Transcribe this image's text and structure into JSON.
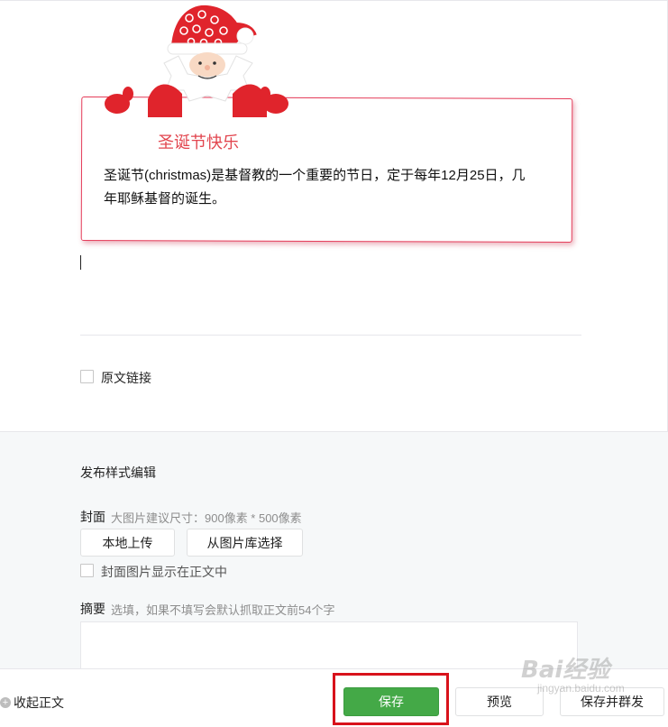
{
  "card": {
    "title": "圣诞节快乐",
    "body": "圣诞节(christmas)是基督教的一个重要的节日，定于每年12月25日，几年耶稣基督的诞生。"
  },
  "source_link": {
    "label": "原文链接",
    "checked": false
  },
  "publish_style": {
    "title": "发布样式编辑",
    "cover_label": "封面",
    "cover_hint": "大图片建议尺寸：900像素 * 500像素",
    "upload_local": "本地上传",
    "choose_library": "从图片库选择",
    "show_in_body": "封面图片显示在正文中",
    "summary_label": "摘要",
    "summary_hint": "选填，如果不填写会默认抓取正文前54个字",
    "summary_value": ""
  },
  "footer": {
    "collapse_label": "收起正文",
    "save_label": "保存",
    "preview_label": "预览",
    "save_publish_label": "保存并群发"
  },
  "watermark": {
    "brand": "Bai经验",
    "url": "jingyan.baidu.com"
  },
  "colors": {
    "primary": "#44a947",
    "card_border": "#e53e5b",
    "title_red": "#e2464f",
    "highlight": "#d8121b"
  },
  "icons": [
    "santa-illustration",
    "plus-circle-icon"
  ]
}
